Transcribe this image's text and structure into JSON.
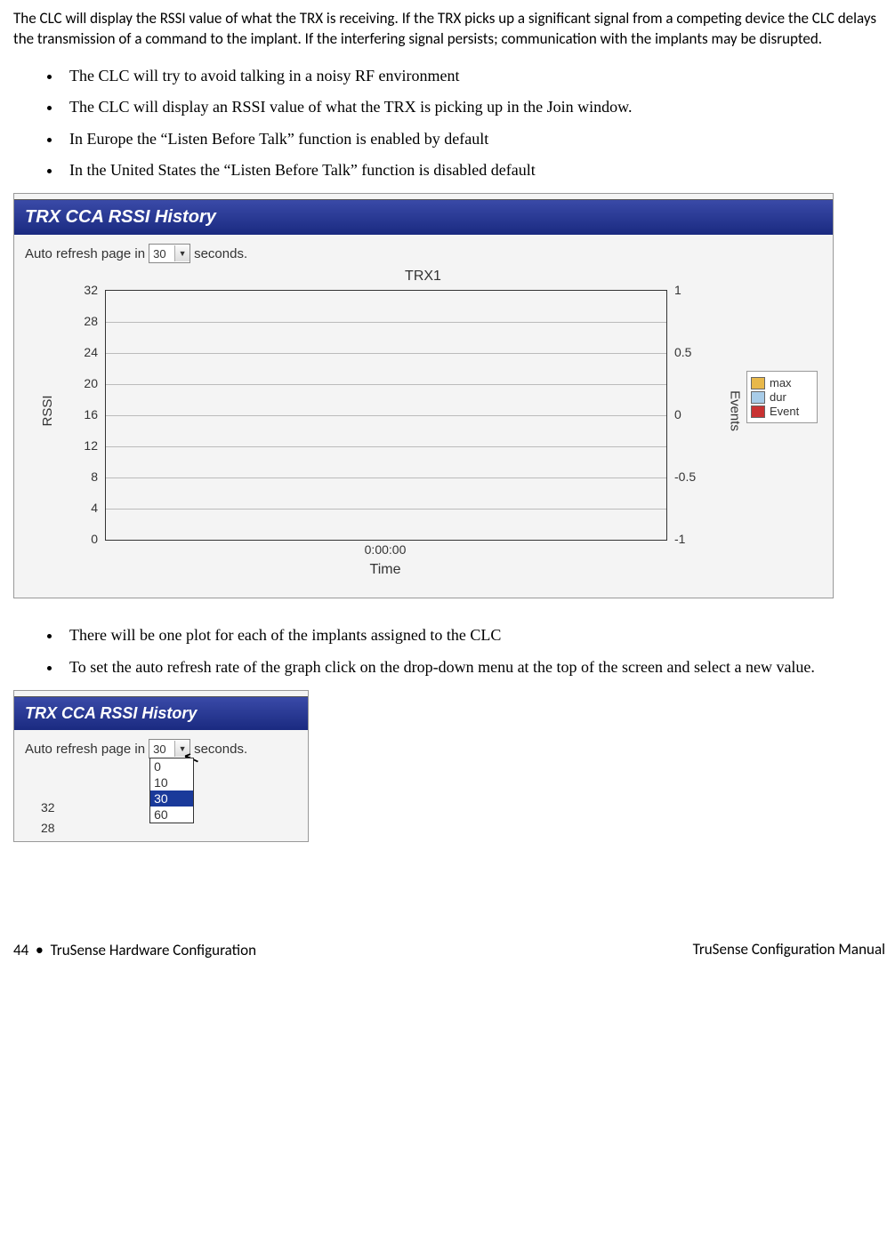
{
  "intro": "The CLC will display the RSSI value of what the TRX is receiving.  If the TRX picks up a significant signal from a competing device the CLC delays the transmission of a command to the implant. If the interfering signal persists; communication with the implants may be disrupted.",
  "bullets1": [
    "The CLC will try to avoid talking in a noisy RF environment",
    "The CLC will display an RSSI value of what the TRX is picking up in the Join window.",
    " In Europe the “Listen Before Talk” function is enabled by default",
    "In the United States the “Listen Before Talk” function is disabled default"
  ],
  "panel1": {
    "title": "TRX CCA RSSI History",
    "refresh_prefix": "Auto refresh page in",
    "refresh_value": "30",
    "refresh_suffix": "seconds."
  },
  "chart_data": {
    "type": "line",
    "title": "TRX1",
    "xlabel": "Time",
    "ylabel_left": "RSSI",
    "ylabel_right": "Events",
    "x_ticks": [
      "0:00:00"
    ],
    "y_left_ticks": [
      0,
      4,
      8,
      12,
      16,
      20,
      24,
      28,
      32
    ],
    "y_right_ticks": [
      -1.0,
      -0.5,
      0.0,
      0.5,
      1.0
    ],
    "ylim_left": [
      0,
      32
    ],
    "ylim_right": [
      -1.0,
      1.0
    ],
    "series": [
      {
        "name": "max",
        "color": "#e8b84a",
        "values": []
      },
      {
        "name": "dur",
        "color": "#a8cce8",
        "values": []
      },
      {
        "name": "Event",
        "color": "#c83232",
        "values": []
      }
    ]
  },
  "bullets2": [
    "There will be one plot for each of the implants assigned to the CLC",
    "To set the auto refresh rate of the graph click on the drop-down menu at the top of the screen and select a new value."
  ],
  "panel2": {
    "title": "TRX CCA RSSI History",
    "refresh_prefix": "Auto refresh page in",
    "refresh_value": "30",
    "refresh_suffix": "seconds.",
    "options": [
      "0",
      "10",
      "30",
      "60"
    ],
    "selected": "30",
    "mini_ticks": [
      "32",
      "28"
    ]
  },
  "footer": {
    "left_page": "44",
    "left_sep": "•",
    "left_text": "TruSense Hardware Configuration",
    "right": "TruSense Configuration Manual"
  }
}
